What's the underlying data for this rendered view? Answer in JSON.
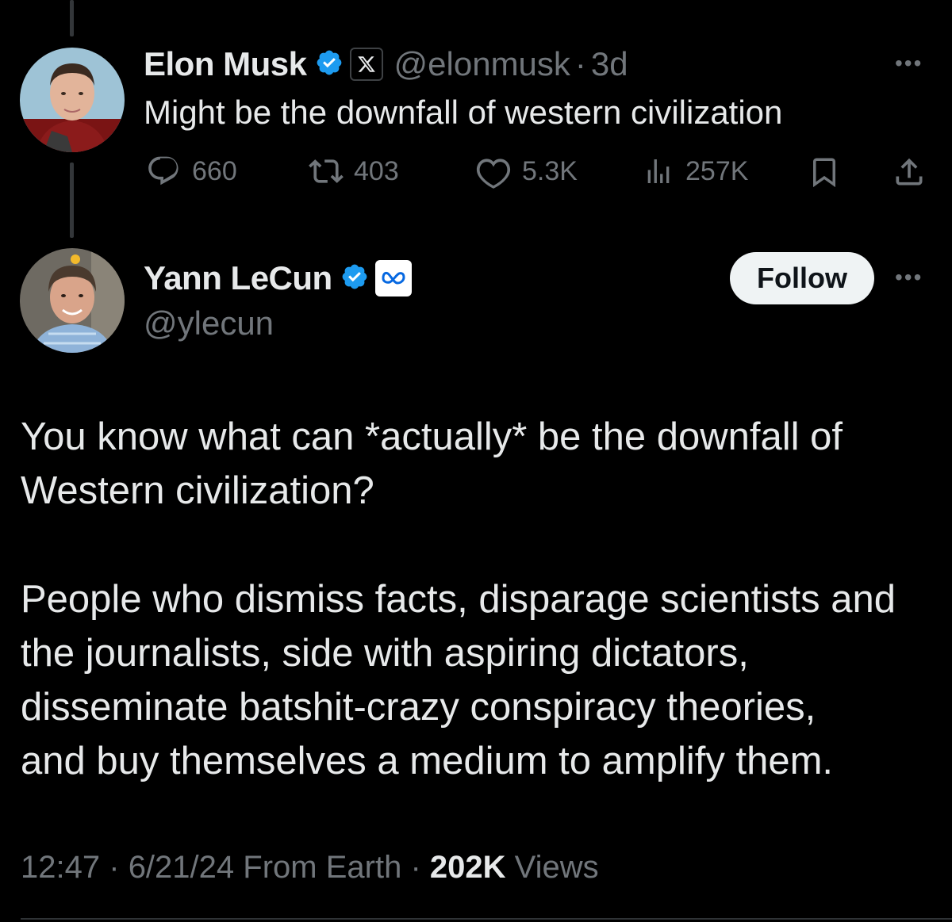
{
  "parent_tweet": {
    "author_name": "Elon Musk",
    "handle": "@elonmusk",
    "separator": "·",
    "time_ago": "3d",
    "text": "Might be the downfall of western civilization",
    "replies": "660",
    "reposts": "403",
    "likes": "5.3K",
    "views": "257K",
    "more_label": "•••"
  },
  "main_tweet": {
    "author_name": "Yann LeCun",
    "handle": "@ylecun",
    "follow_label": "Follow",
    "more_label": "•••",
    "paragraph1_line1": "You know what can *actually* be the downfall of",
    "paragraph1_line2": "Western civilization?",
    "paragraph2_line1": "People who dismiss facts, disparage scientists and",
    "paragraph2_line2": "the journalists, side with aspiring dictators,",
    "paragraph2_line3": "disseminate batshit-crazy conspiracy theories,",
    "paragraph2_line4": "and buy themselves a medium to amplify them.",
    "time": "12:47",
    "date": "6/21/24",
    "source": "From Earth",
    "separator": "·",
    "view_count": "202K",
    "views_label": "Views"
  },
  "colors": {
    "background": "#000000",
    "text": "#e7e9ea",
    "muted": "#71767b",
    "verified": "#1d9bf0"
  },
  "icons": [
    "verified-badge-icon",
    "x-affiliation-icon",
    "meta-affiliation-icon",
    "reply-icon",
    "repost-icon",
    "like-icon",
    "views-icon",
    "bookmark-icon",
    "share-icon"
  ]
}
